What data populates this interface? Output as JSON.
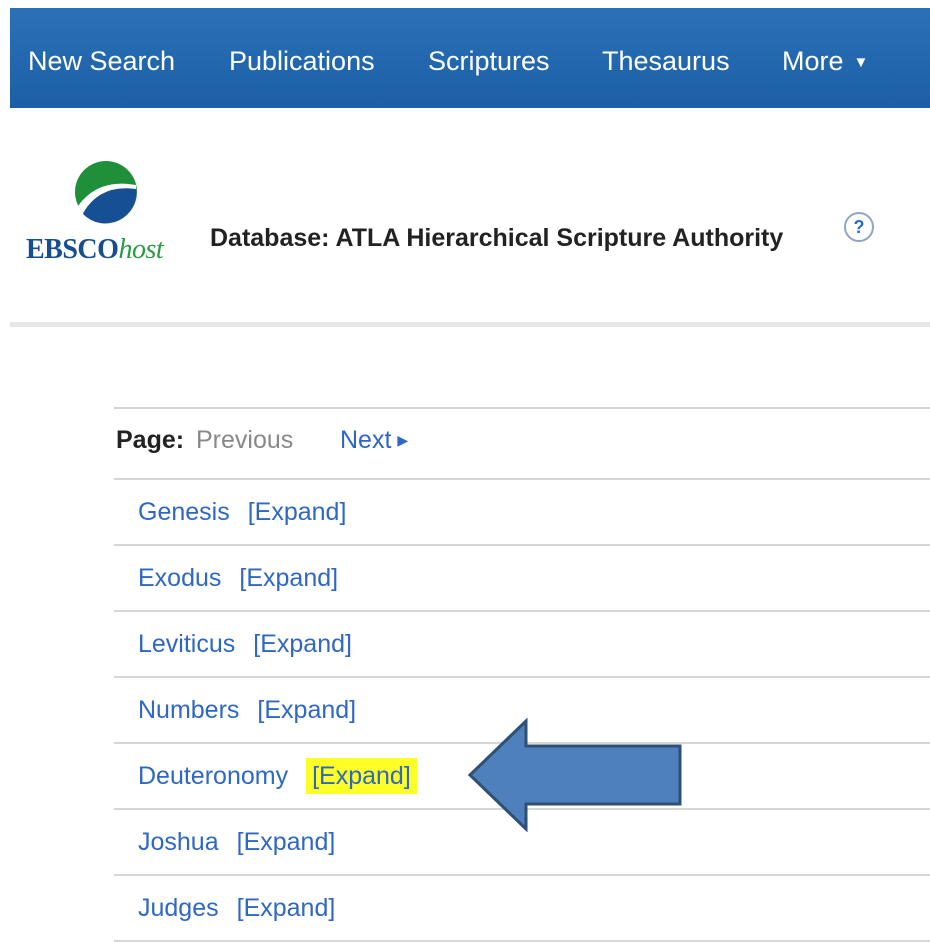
{
  "nav": {
    "items": [
      "New Search",
      "Publications",
      "Scriptures",
      "Thesaurus"
    ],
    "more_label": "More",
    "bg_color": "#1f63aa"
  },
  "brand": {
    "logo_main": "EBSCO",
    "logo_suffix": "host"
  },
  "header": {
    "title": "Database: ATLA Hierarchical Scripture Authority",
    "help_label": "?"
  },
  "pager": {
    "label": "Page:",
    "previous": "Previous",
    "next": "Next"
  },
  "books": [
    {
      "name": "Genesis",
      "expand": "[Expand]"
    },
    {
      "name": "Exodus",
      "expand": "[Expand]"
    },
    {
      "name": "Leviticus",
      "expand": "[Expand]"
    },
    {
      "name": "Numbers",
      "expand": "[Expand]"
    },
    {
      "name": "Deuteronomy",
      "expand": "[Expand]"
    },
    {
      "name": "Joshua",
      "expand": "[Expand]"
    },
    {
      "name": "Judges",
      "expand": "[Expand]"
    }
  ],
  "annotation": {
    "highlighted_book": "Deuteronomy",
    "highlight_color": "#ffff28",
    "arrow_color": "#4e80bd"
  }
}
